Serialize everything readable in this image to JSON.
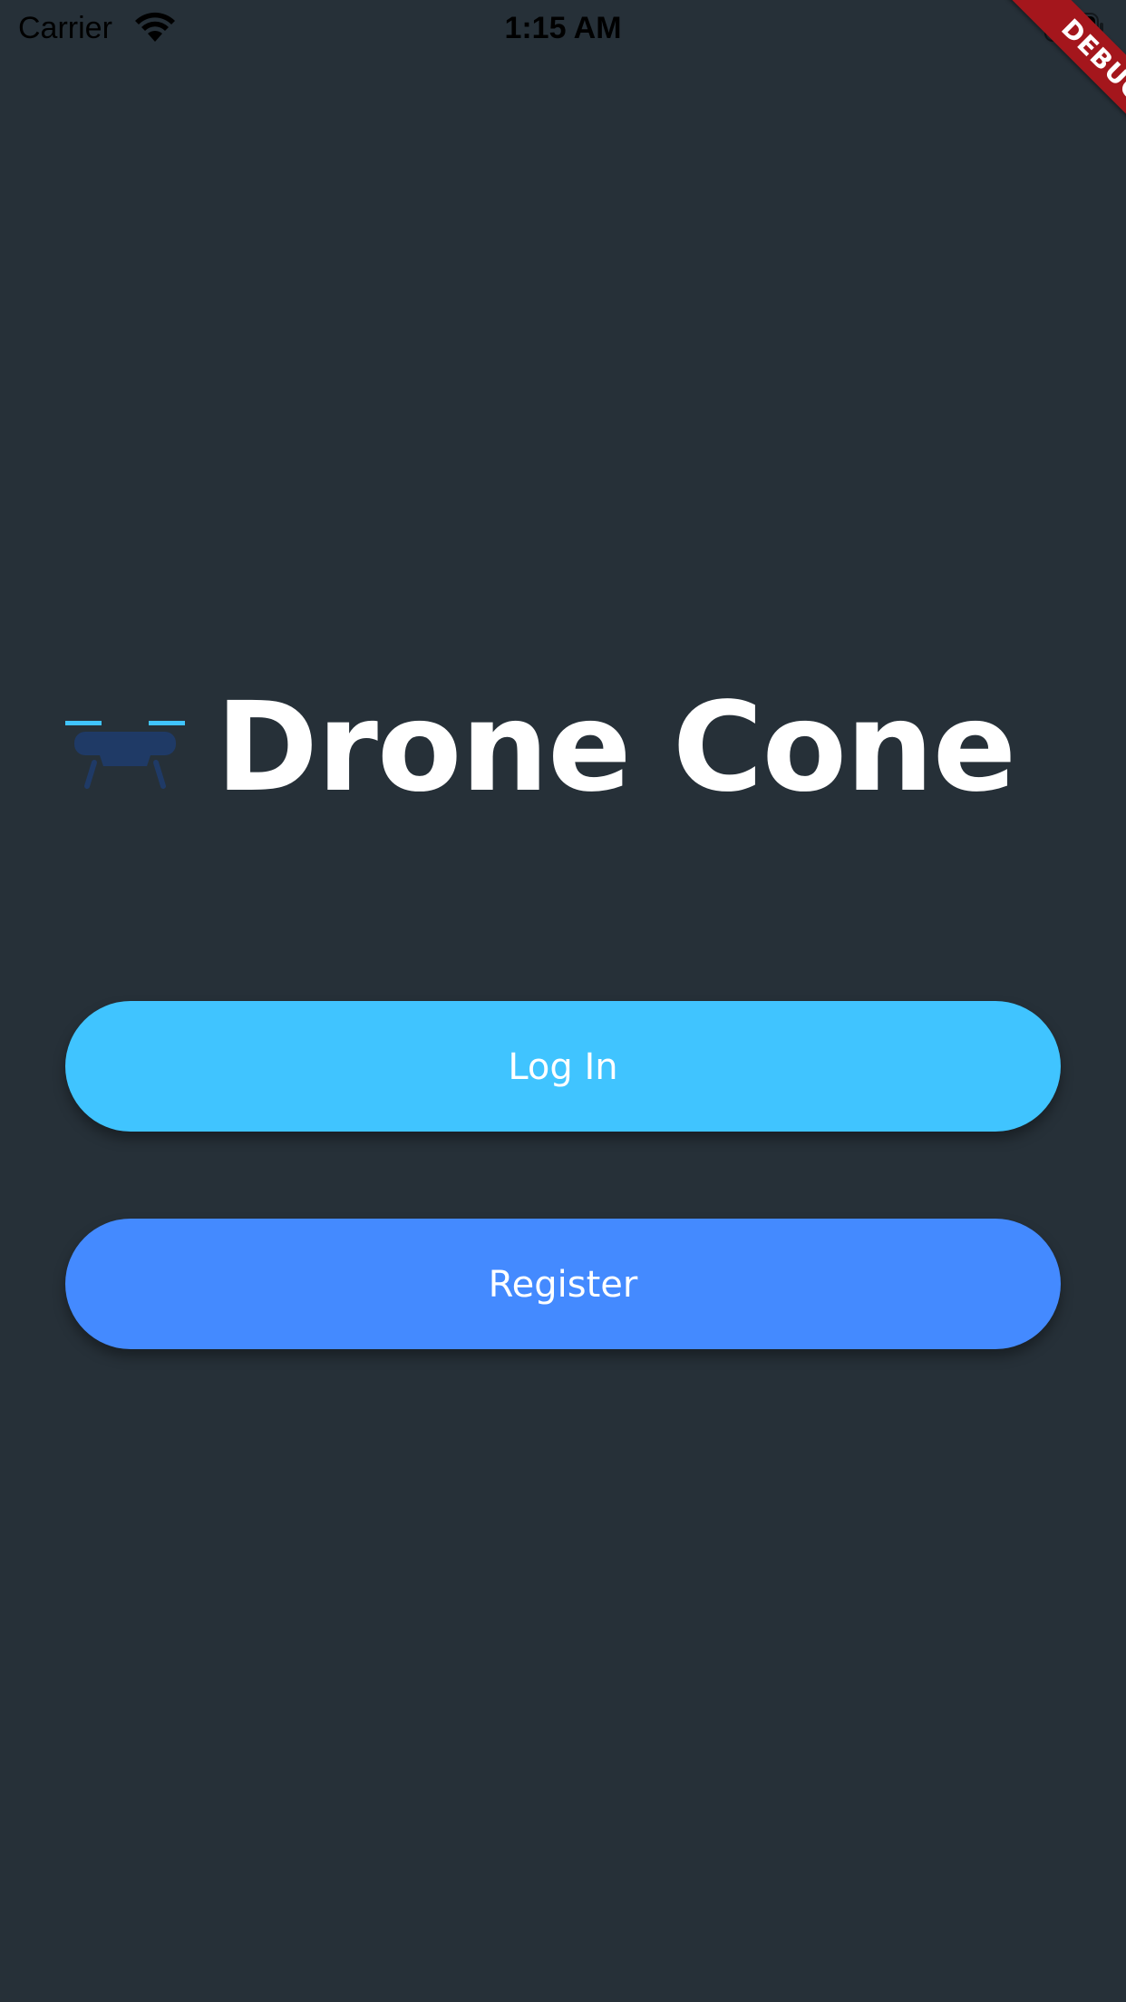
{
  "status_bar": {
    "carrier": "Carrier",
    "time": "1:15 AM",
    "wifi_icon": "wifi-icon",
    "battery_icon": "battery-icon"
  },
  "debug_banner": {
    "label": "DEBUG",
    "color": "#a4161c"
  },
  "app": {
    "title": "Drone Cone",
    "logo_icon": "drone-icon",
    "background": "#263038"
  },
  "actions": {
    "login_label": "Log In",
    "login_color": "#40c4ff",
    "register_label": "Register",
    "register_color": "#448aff"
  }
}
